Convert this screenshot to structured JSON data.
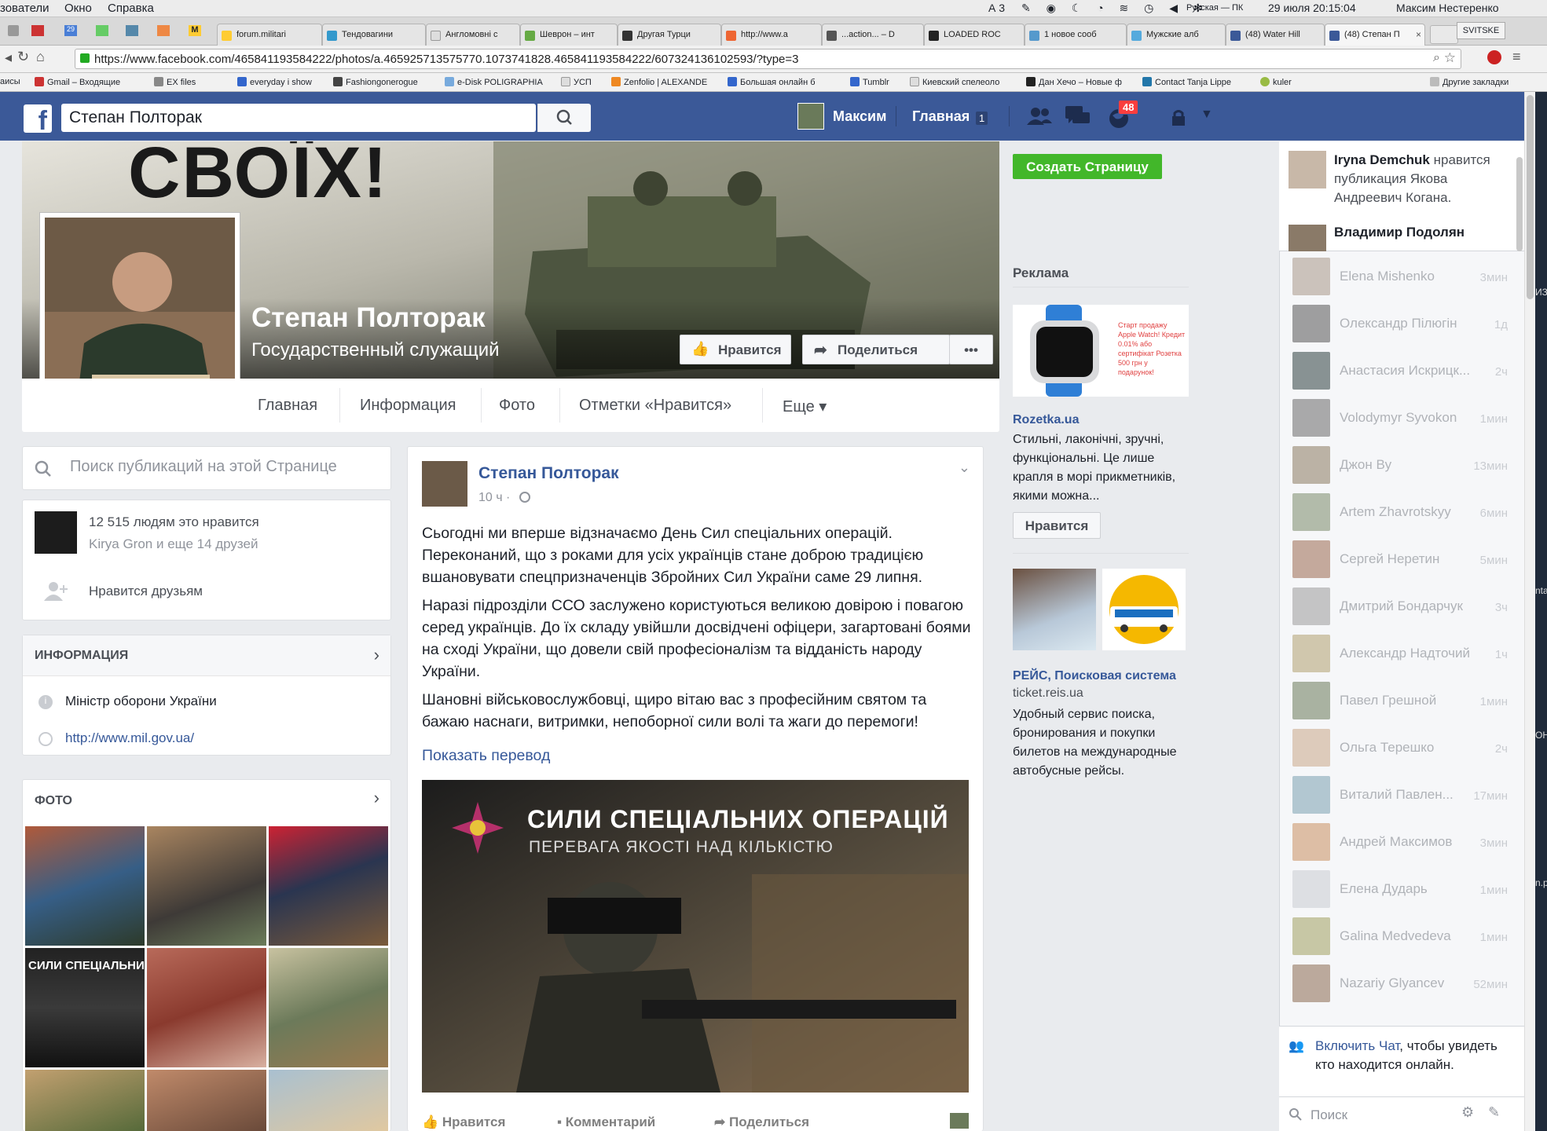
{
  "mac_menu": {
    "items": [
      "зователи",
      "Окно",
      "Справка"
    ],
    "right": [
      "А 3",
      "Русская — ПК",
      "29 июля  20:15:04",
      "Максим Нестеренко"
    ]
  },
  "tabs": [
    {
      "label": "forum.militari"
    },
    {
      "label": "Тендовагини"
    },
    {
      "label": "Англомовні с"
    },
    {
      "label": "Шеврон – инт"
    },
    {
      "label": "Другая Турци"
    },
    {
      "label": "http://www.a"
    },
    {
      "label": "...action... – D"
    },
    {
      "label": "LOADED ROC"
    },
    {
      "label": "1 новое сооб"
    },
    {
      "label": "Мужские алб"
    },
    {
      "label": "(48) Water Hill"
    },
    {
      "label": "(48) Степан П"
    }
  ],
  "tab_right_label": "SVITSKE",
  "url": "https://www.facebook.com/465841193584222/photos/a.465925713575770.1073741828.465841193584222/607324136102593/?type=3",
  "bookmarks": [
    "аисы",
    "Gmail – Входящие",
    "EX files",
    "everyday i show",
    "Fashiongonerogue",
    "e-Disk POLIGRAPHIA",
    "УСП",
    "Zenfolio | ALEXANDE",
    "Большая онлайн б",
    "Tumblr",
    "Киевский спелеоло",
    "Дан Хечо – Новые ф",
    "Contact Tanja Lippe",
    "kuler",
    "Другие закладки"
  ],
  "topnav": {
    "search_value": "Степан Полторак",
    "user": "Максим",
    "home": "Главная",
    "home_count": "1",
    "notif_count": "48"
  },
  "cover": {
    "headline": "СВОЇХ!",
    "name": "Степан Полторак",
    "category": "Государственный служащий",
    "like_btn": "Нравится",
    "share_btn": "Поделиться",
    "more_btn": "•••"
  },
  "page_tabs": [
    "Главная",
    "Информация",
    "Фото",
    "Отметки «Нравится»",
    "Еще ▾"
  ],
  "left": {
    "search_placeholder": "Поиск публикаций на этой Странице",
    "likes_count": "12 515 людям это нравится",
    "likes_friends": "Kirya Gron и еще 14 друзей",
    "friends_like": "Нравится друзьям",
    "info_header": "ИНФОРМАЦИЯ",
    "info_role": "Міністр оборони України",
    "info_link": "http://www.mil.gov.ua/",
    "photo_header": "ФОТО"
  },
  "post": {
    "author": "Степан Полторак",
    "time": "10 ч ·",
    "p1": "Сьогодні ми вперше відзначаємо День Сил спеціальних операцій. Переконаний, що з роками для усіх українців стане доброю традицією вшановувати спецпризначенців Збройних Сил України саме 29 липня.",
    "p2": "Наразі підрозділи ССО заслужено користуються великою довірою і повагою серед українців. До їх складу увійшли досвідчені офіцери, загартовані боями на сході України, що довели свій професіоналізм та відданість народу України.",
    "p3": "Шановні військовослужбовці, щиро вітаю вас з професійним святом та бажаю наснаги, витримки, непоборної сили волі та жаги до перемоги!",
    "translate": "Показать перевод",
    "image_title": "СИЛИ СПЕЦІАЛЬНИХ ОПЕРАЦІЙ",
    "image_sub": "ПЕРЕВАГА ЯКОСТІ НАД КІЛЬКІСТЮ",
    "act_like": "Нравится",
    "act_comment": "Комментарий",
    "act_share": "Поделиться"
  },
  "right": {
    "create_page": "Создать Страницу",
    "ads_header": "Реклама",
    "ad1_title": "Rozetka.ua",
    "ad1_img_text": "Старт продажу Apple Watch! Кредит 0.01% або сертифікат Розетка 500 грн у подарунок!",
    "ad1_text": "Стильні, лаконічні, зручні, функціональні. Це лише крапля в морі прикметників, якими можна...",
    "ad1_like": "Нравится",
    "ad2_title": "РЕЙС, Поисковая система",
    "ad2_domain": "ticket.reis.ua",
    "ad2_text": "Удобный сервис поиска, бронирования и покупки билетов на международные автобусные рейсы."
  },
  "ticker": {
    "name1": "Iryna Demchuk",
    "text1": " нравится публикация Якова Андреевич Когана.",
    "name2": "Владимир Подолян"
  },
  "chat": [
    {
      "name": "Elena Mishenko",
      "time": "3мин"
    },
    {
      "name": "Олександр Пілюгін",
      "time": "1д"
    },
    {
      "name": "Анастасия Искрицк...",
      "time": "2ч"
    },
    {
      "name": "Volodymyr Syvokon",
      "time": "1мин"
    },
    {
      "name": "Джон Ву",
      "time": "13мин"
    },
    {
      "name": "Artem Zhavrotskyy",
      "time": "6мин"
    },
    {
      "name": "Сергей Неретин",
      "time": "5мин"
    },
    {
      "name": "Дмитрий Бондарчук",
      "time": "3ч"
    },
    {
      "name": "Александр Надточий",
      "time": "1ч"
    },
    {
      "name": "Павел Грешной",
      "time": "1мин"
    },
    {
      "name": "Ольга Терешко",
      "time": "2ч"
    },
    {
      "name": "Виталий Павлен...",
      "time": "17мин"
    },
    {
      "name": "Андрей Максимов",
      "time": "3мин"
    },
    {
      "name": "Елена Дударь",
      "time": "1мин"
    },
    {
      "name": "Galina Medvedeva",
      "time": "1мин"
    },
    {
      "name": "Nazariy Glyancev",
      "time": "52мин"
    }
  ],
  "chat_footer": {
    "enable": "Включить Чат",
    "rest": ", чтобы увидеть кто находится онлайн.",
    "search": "Поиск"
  },
  "edge_fragments": [
    "ИЗ",
    "nta",
    "ОН",
    "n.p"
  ]
}
